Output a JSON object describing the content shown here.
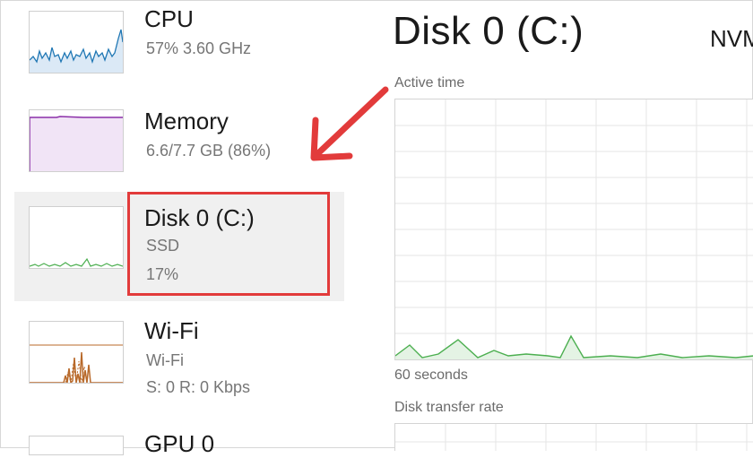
{
  "sidebar": {
    "items": [
      {
        "title": "CPU",
        "sub1": "57%  3.60 GHz"
      },
      {
        "title": "Memory",
        "sub1": "6.6/7.7 GB (86%)"
      },
      {
        "title": "Disk 0 (C:)",
        "sub1": "SSD",
        "sub2": "17%"
      },
      {
        "title": "Wi-Fi",
        "sub1": "Wi-Fi",
        "sub2": "S: 0  R: 0 Kbps"
      },
      {
        "title": "GPU 0"
      }
    ]
  },
  "main": {
    "title": "Disk 0 (C:)",
    "model": "NVM",
    "active_time_label": "Active time",
    "time_span_label": "60 seconds",
    "transfer_rate_label": "Disk transfer rate"
  },
  "colors": {
    "cpu": "#1f77b4",
    "memory": "#8b2fa8",
    "disk": "#4caf50",
    "wifi": "#b8692a",
    "annotation": "#e23b3b"
  }
}
